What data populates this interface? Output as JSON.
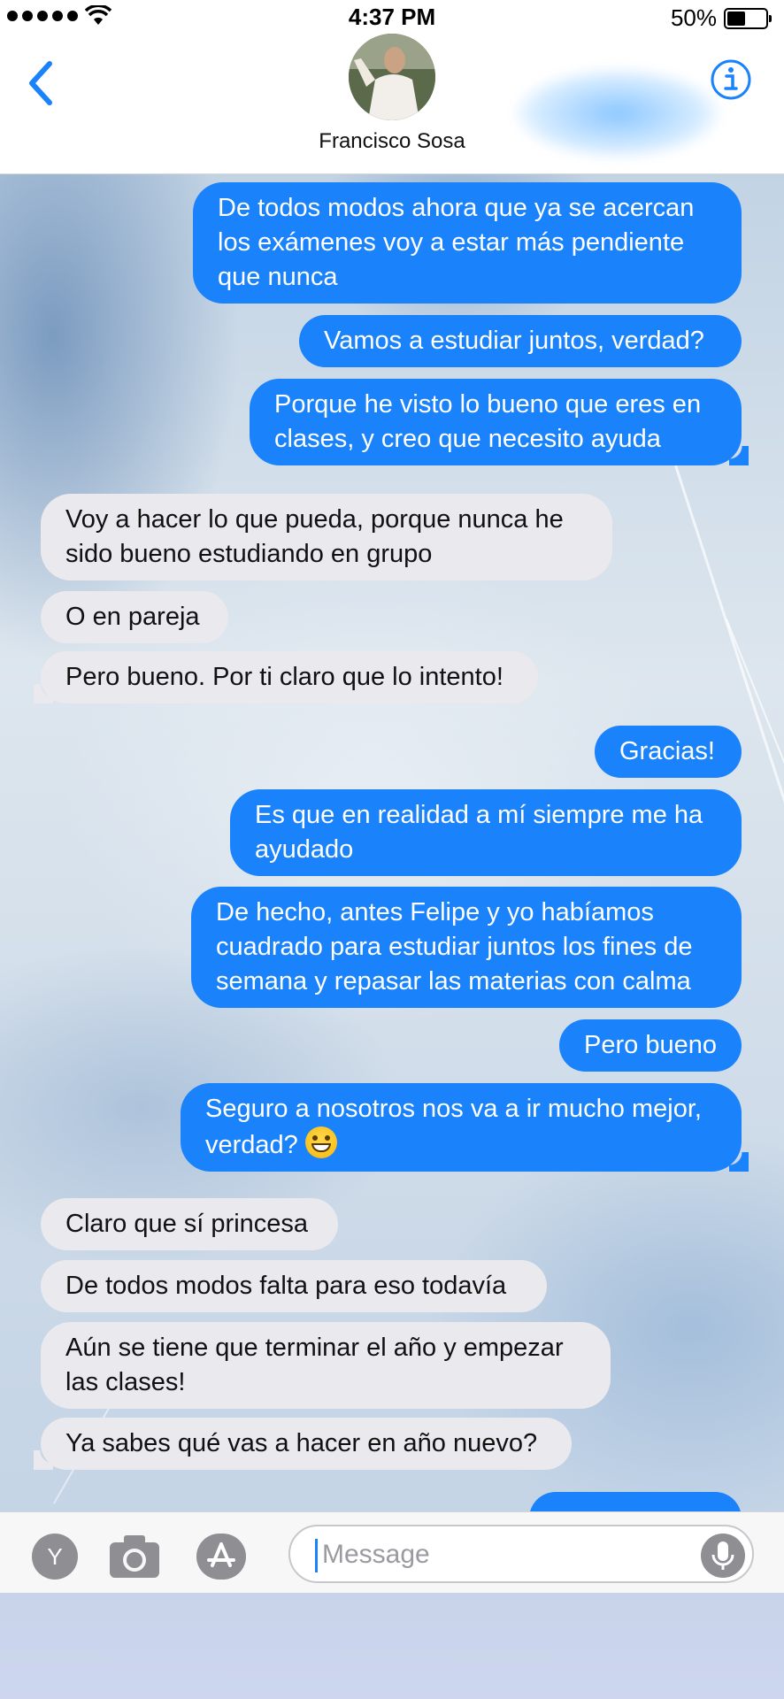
{
  "status_bar": {
    "time": "4:37 PM",
    "battery_percent": "50%",
    "battery_level": 0.5,
    "signal_bars": 5
  },
  "header": {
    "contact_name": "Francisco Sosa",
    "back_icon": "chevron-left-icon",
    "info_icon": "info-icon"
  },
  "messages": [
    {
      "side": "outgoing",
      "lines": [
        "De todos modos ahora que ya se acercan",
        "los exámenes voy a estar más pendiente",
        "que nunca"
      ]
    },
    {
      "side": "outgoing",
      "lines": [
        "Vamos a estudiar juntos, verdad?"
      ]
    },
    {
      "side": "outgoing",
      "lines": [
        "Porque he visto lo bueno que eres en",
        "clases, y creo que necesito ayuda"
      ]
    },
    {
      "side": "incoming",
      "lines": [
        "Voy a hacer lo que pueda, porque nunca he",
        "sido bueno estudiando en grupo"
      ]
    },
    {
      "side": "incoming",
      "lines": [
        "O en pareja"
      ]
    },
    {
      "side": "incoming",
      "lines": [
        "Pero bueno. Por ti claro que lo intento!"
      ]
    },
    {
      "side": "outgoing",
      "lines": [
        "Gracias!"
      ]
    },
    {
      "side": "outgoing",
      "lines": [
        "Es que en realidad a mí siempre me ha",
        "ayudado"
      ]
    },
    {
      "side": "outgoing",
      "lines": [
        "De hecho, antes Felipe y yo habíamos",
        "cuadrado para estudiar juntos los fines de",
        "semana y repasar las materias con calma"
      ]
    },
    {
      "side": "outgoing",
      "lines": [
        "Pero bueno"
      ]
    },
    {
      "side": "outgoing",
      "lines": [
        "Seguro a nosotros nos va a ir mucho mejor,",
        "verdad?"
      ],
      "emoji": "grinning-face-emoji"
    },
    {
      "side": "incoming",
      "lines": [
        "Claro que sí princesa"
      ]
    },
    {
      "side": "incoming",
      "lines": [
        "De todos modos falta para eso todavía"
      ]
    },
    {
      "side": "incoming",
      "lines": [
        "Aún se tiene que terminar el año y empezar",
        "las clases!"
      ]
    },
    {
      "side": "incoming",
      "lines": [
        "Ya sabes qué vas a hacer en año nuevo?"
      ]
    }
  ],
  "input_bar": {
    "placeholder": "Message",
    "app_button_label": "Y",
    "camera_icon": "camera-icon",
    "apps_icon": "app-store-icon",
    "mic_icon": "microphone-icon"
  },
  "colors": {
    "outgoing_bubble": "#1a82fb",
    "incoming_bubble": "#e9e9ee",
    "accent": "#1a82fb"
  }
}
